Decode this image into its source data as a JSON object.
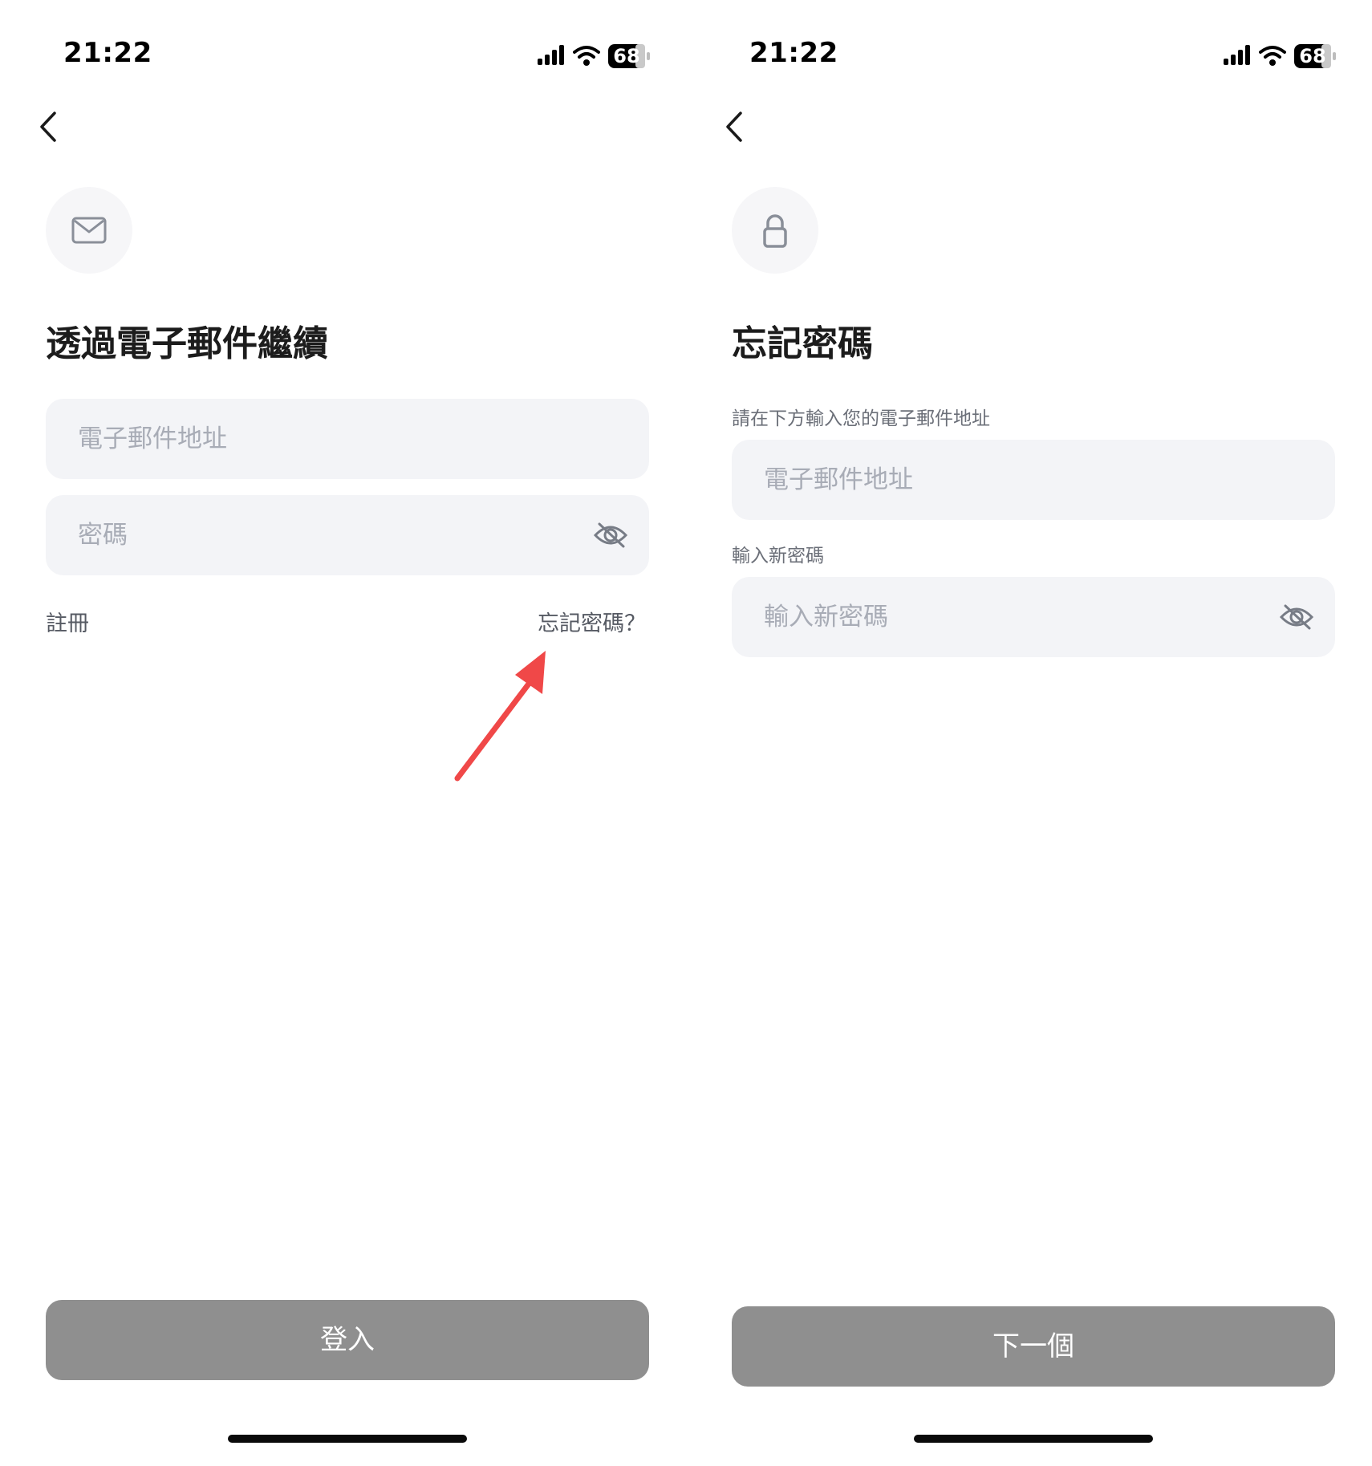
{
  "status_bar": {
    "time": "21:22",
    "battery": "68"
  },
  "login": {
    "title": "透過電子郵件繼續",
    "email_placeholder": "電子郵件地址",
    "password_placeholder": "密碼",
    "register_label": "註冊",
    "forgot_label": "忘記密碼？",
    "login_button": "登入",
    "hero_icon": "mail-icon"
  },
  "forgot": {
    "title": "忘記密碼",
    "email_label": "請在下方輸入您的電子郵件地址",
    "email_placeholder": "電子郵件地址",
    "new_password_label": "輸入新密碼",
    "new_password_placeholder": "輸入新密碼",
    "next_button": "下一個",
    "hero_icon": "lock-icon"
  },
  "colors": {
    "input_bg": "#f3f4f7",
    "button_bg": "#8f8f8f",
    "annotation_arrow": "#f04848",
    "placeholder": "#a8acb6"
  }
}
